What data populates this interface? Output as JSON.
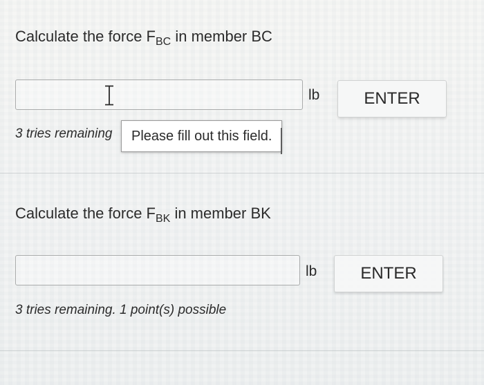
{
  "questions": [
    {
      "prompt_prefix": "Calculate the force F",
      "prompt_subscript": "BC",
      "prompt_suffix": " in member BC",
      "input_value": "",
      "unit": "lb",
      "enter_label": "ENTER",
      "tries_text": "3 tries remaining",
      "tooltip": "Please fill out this field."
    },
    {
      "prompt_prefix": "Calculate the force F",
      "prompt_subscript": "BK",
      "prompt_suffix": " in member BK",
      "input_value": "",
      "unit": "lb",
      "enter_label": "ENTER",
      "tries_text": "3 tries remaining. 1 point(s) possible"
    }
  ],
  "icons": {
    "cursor": "text-cursor-icon"
  }
}
